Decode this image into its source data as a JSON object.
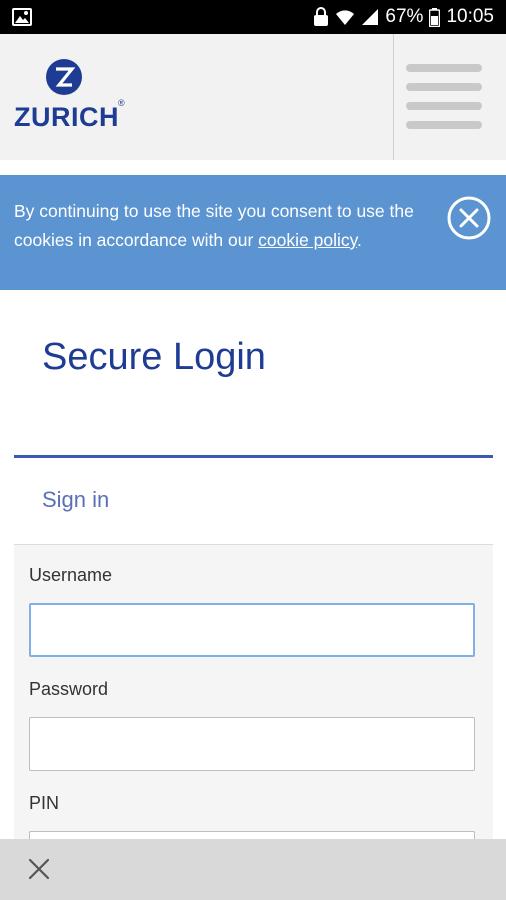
{
  "status_bar": {
    "battery": "67%",
    "time": "10:05"
  },
  "header": {
    "logo_text": "ZURICH",
    "logo_registered": "®"
  },
  "cookie_banner": {
    "message_prefix": "By continuing to use the site you consent to use the cookies in accordance with our ",
    "link_text": "cookie policy",
    "message_suffix": "."
  },
  "login": {
    "title": "Secure Login",
    "tab_label": "Sign in",
    "username_label": "Username",
    "username_value": "",
    "password_label": "Password",
    "password_value": "",
    "pin_label": "PIN",
    "pin_value": ""
  },
  "colors": {
    "brand": "#1f3c94",
    "banner": "#5b94d1",
    "accent_rule": "#3a5cb0"
  }
}
